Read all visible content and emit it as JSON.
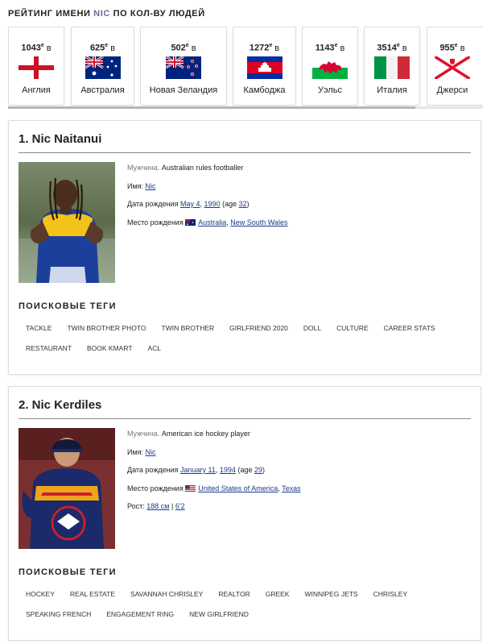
{
  "header": {
    "prefix": "РЕЙТИНГ ИМЕНИ",
    "name": "NIC",
    "suffix": "ПО КОЛ-ВУ ЛЮДЕЙ"
  },
  "countries": [
    {
      "rank": "1043",
      "sup": "е",
      "suffix": "в",
      "name": "Англия",
      "flag": "england-flag"
    },
    {
      "rank": "625",
      "sup": "е",
      "suffix": "в",
      "name": "Австралия",
      "flag": "australia-flag"
    },
    {
      "rank": "502",
      "sup": "е",
      "suffix": "в",
      "name": "Новая Зеландия",
      "flag": "new-zealand-flag"
    },
    {
      "rank": "1272",
      "sup": "е",
      "suffix": "в",
      "name": "Камбоджа",
      "flag": "cambodia-flag"
    },
    {
      "rank": "1143",
      "sup": "е",
      "suffix": "в",
      "name": "Уэльс",
      "flag": "wales-flag"
    },
    {
      "rank": "3514",
      "sup": "е",
      "suffix": "в",
      "name": "Италия",
      "flag": "italy-flag"
    },
    {
      "rank": "955",
      "sup": "е",
      "suffix": "в",
      "name": "Джерси",
      "flag": "jersey-flag"
    }
  ],
  "people": [
    {
      "title": "1. Nic Naitanui",
      "gender": "Мужчина.",
      "occupation": "Australian rules footballer",
      "name_label": "Имя:",
      "name_value": "Nic",
      "birth_label": "Дата рождения",
      "birth_date": "May 4",
      "birth_year": "1990",
      "age_prefix": "(age",
      "age": "32",
      "age_suffix": ")",
      "place_label": "Место рождения",
      "place_country": "Australia",
      "place_region": "New South Wales",
      "tags_title": "ПОИСКОВЫЕ ТЕГИ",
      "tags": [
        "TACKLE",
        "TWIN BROTHER PHOTO",
        "TWIN BROTHER",
        "GIRLFRIEND 2020",
        "DOLL",
        "CULTURE",
        "CAREER STATS",
        "RESTAURANT",
        "BOOK KMART",
        "ACL"
      ]
    },
    {
      "title": "2. Nic Kerdiles",
      "gender": "Мужчина.",
      "occupation": "American ice hockey player",
      "name_label": "Имя:",
      "name_value": "Nic",
      "birth_label": "Дата рождения",
      "birth_date": "January 11",
      "birth_year": "1994",
      "age_prefix": "(age",
      "age": "29",
      "age_suffix": ")",
      "place_label": "Место рождения",
      "place_country": "United States of America",
      "place_region": "Texas",
      "height_label": "Рост:",
      "height_cm": "188 см",
      "height_sep": "|",
      "height_ft": "6'2",
      "tags_title": "ПОИСКОВЫЕ ТЕГИ",
      "tags": [
        "HOCKEY",
        "REAL ESTATE",
        "SAVANNAH CHRISLEY",
        "REALTOR",
        "GREEK",
        "WINNIPEG JETS",
        "CHRISLEY",
        "SPEAKING FRENCH",
        "ENGAGEMENT RING",
        "NEW GIRLFRIEND"
      ]
    }
  ],
  "colors": {
    "link": "#1a3a8a",
    "rule": "#8a8a8a",
    "border": "#dcdcdc",
    "accent_name": "#6b6b9a"
  }
}
